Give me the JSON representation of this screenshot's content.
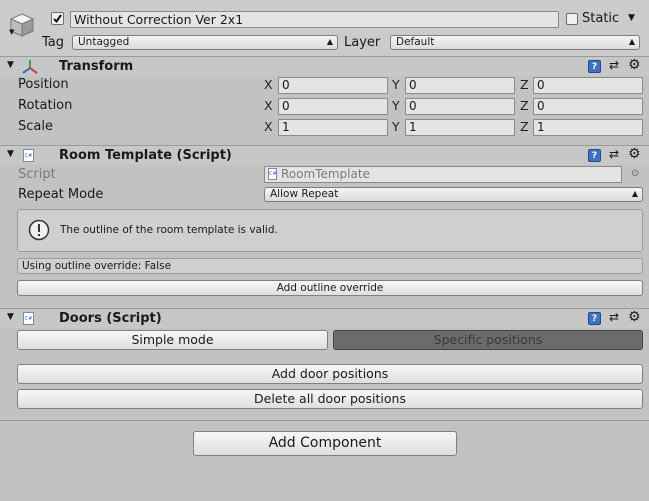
{
  "gameobject": {
    "active": true,
    "name": "Without Correction Ver 2x1",
    "static_label": "Static",
    "static_checked": false,
    "tag_label": "Tag",
    "tag_value": "Untagged",
    "layer_label": "Layer",
    "layer_value": "Default"
  },
  "transform": {
    "title": "Transform",
    "rows": [
      {
        "label": "Position",
        "x": "0",
        "y": "0",
        "z": "0"
      },
      {
        "label": "Rotation",
        "x": "0",
        "y": "0",
        "z": "0"
      },
      {
        "label": "Scale",
        "x": "1",
        "y": "1",
        "z": "1"
      }
    ],
    "axis_x": "X",
    "axis_y": "Y",
    "axis_z": "Z"
  },
  "room_template": {
    "title": "Room Template (Script)",
    "script_label": "Script",
    "script_value": "RoomTemplate",
    "repeat_label": "Repeat Mode",
    "repeat_value": "Allow Repeat",
    "info_text": "The outline of the room template is valid.",
    "override_text": "Using outline override: False",
    "add_override_button": "Add outline override"
  },
  "doors": {
    "title": "Doors (Script)",
    "simple_mode": "Simple mode",
    "specific_positions": "Specific positions",
    "add_positions": "Add door positions",
    "delete_positions": "Delete all door positions"
  },
  "add_component": "Add Component",
  "colors": {
    "background": "#c2c2c2",
    "help_icon": "#3e73c4",
    "pressed_button": "#6b6b6b"
  }
}
